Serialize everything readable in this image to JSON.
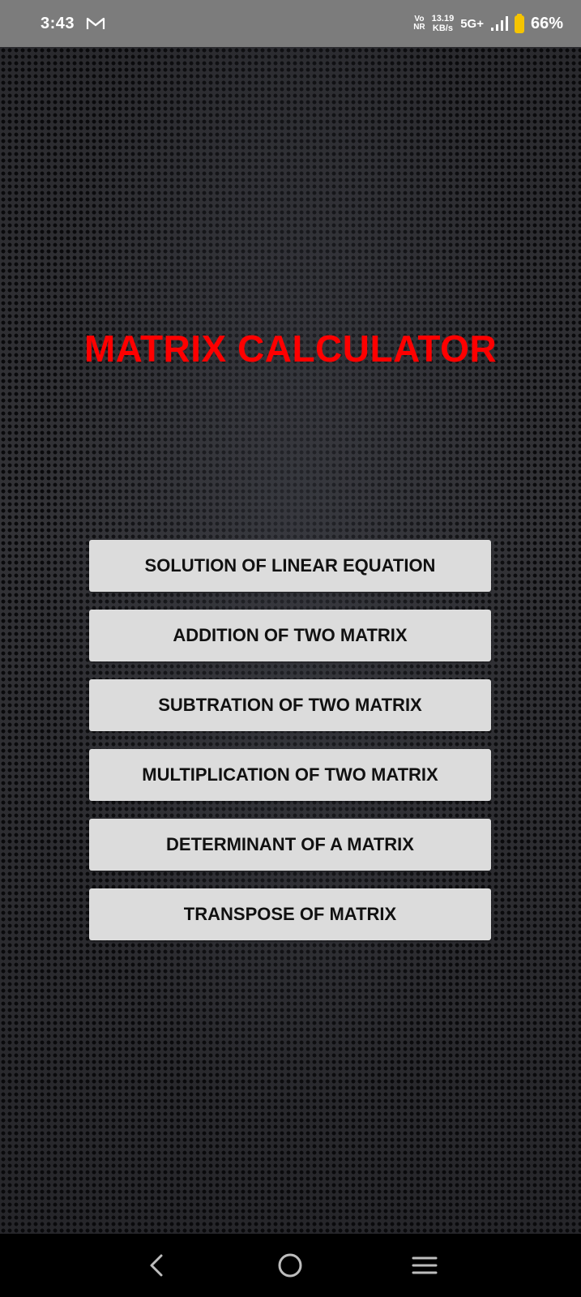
{
  "status_bar": {
    "time": "3:43",
    "notification_icon": "gmail-icon",
    "volte_line1": "Vo",
    "volte_line2": "NR",
    "speed_value": "13.19",
    "speed_unit": "KB/s",
    "network_type": "5G+",
    "signal_icon": "signal-bars-icon",
    "battery_icon": "battery-icon",
    "battery_percent": "66%"
  },
  "app": {
    "title": "MATRIX CALCULATOR",
    "title_color": "#ff0000",
    "buttons": [
      {
        "label": "SOLUTION OF LINEAR EQUATION"
      },
      {
        "label": "ADDITION OF TWO MATRIX"
      },
      {
        "label": "SUBTRATION OF TWO MATRIX"
      },
      {
        "label": "MULTIPLICATION OF TWO MATRIX"
      },
      {
        "label": "DETERMINANT OF A MATRIX"
      },
      {
        "label": "TRANSPOSE OF MATRIX"
      }
    ]
  },
  "nav_bar": {
    "back_icon": "back-chevron-icon",
    "home_icon": "home-circle-icon",
    "recents_icon": "menu-lines-icon"
  }
}
